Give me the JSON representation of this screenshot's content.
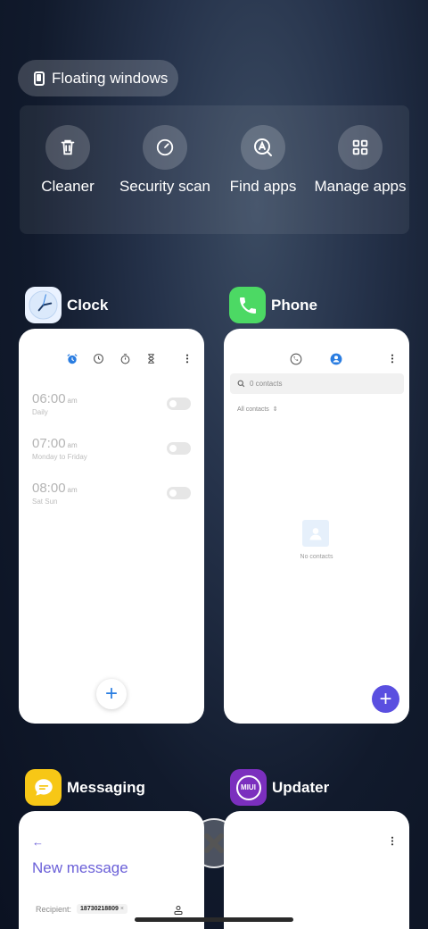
{
  "floating": {
    "label": "Floating windows",
    "icon": "floating-window-icon"
  },
  "quick_actions": [
    {
      "label": "Cleaner",
      "icon": "trash-icon"
    },
    {
      "label": "Security scan",
      "icon": "security-scan-icon"
    },
    {
      "label": "Find apps",
      "icon": "find-apps-icon"
    },
    {
      "label": "Manage apps",
      "icon": "grid-icon"
    }
  ],
  "apps": {
    "clock": {
      "name": "Clock",
      "alarms": [
        {
          "time": "06:00",
          "ampm": "am",
          "days": "Daily"
        },
        {
          "time": "07:00",
          "ampm": "am",
          "days": "Monday to Friday"
        },
        {
          "time": "08:00",
          "ampm": "am",
          "days": "Sat Sun"
        }
      ],
      "fab": "+"
    },
    "phone": {
      "name": "Phone",
      "search_placeholder": "0 contacts",
      "filter": "All contacts",
      "empty_text": "No contacts",
      "fab": "+"
    },
    "messaging": {
      "name": "Messaging",
      "title": "New message",
      "recipient_label": "Recipient:",
      "recipient_chip": "18730218809"
    },
    "updater": {
      "name": "Updater",
      "icon_text": "MIUI"
    }
  },
  "colors": {
    "clock_accent": "#2a7de1",
    "phone_green": "#4cd964",
    "messaging_yellow": "#f7c716",
    "updater_purple": "#7b2fbe",
    "fab_purple": "#5a4fe0",
    "message_title": "#6a5fd8"
  }
}
